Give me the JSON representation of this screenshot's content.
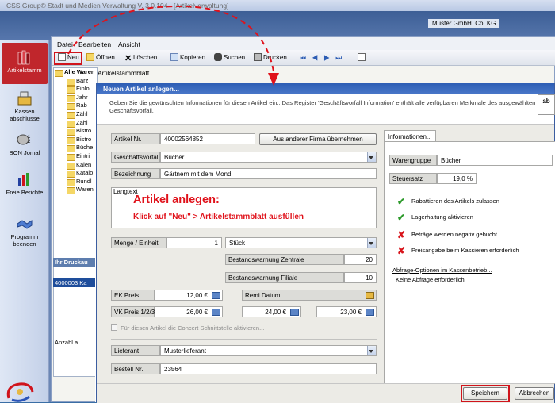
{
  "app": {
    "title": "CSS Group® Stadt und Medien Verwaltung V. 3.0.104 - [Artikelverwaltung]",
    "company": "Muster GmbH .Co. KG"
  },
  "leftnav": {
    "items": [
      {
        "label": "Artikelstamm",
        "icon": "books-icon"
      },
      {
        "label": "Kassen abschlüsse",
        "icon": "cash-register-icon"
      },
      {
        "label": "BON Jornal",
        "icon": "journal-icon"
      },
      {
        "label": "Freie Berichte",
        "icon": "report-chart-icon"
      },
      {
        "label": "Programm beenden",
        "icon": "handshake-icon"
      }
    ]
  },
  "menu": {
    "items": [
      "Datei",
      "Bearbeiten",
      "Ansicht"
    ]
  },
  "toolbar": {
    "neu": "Neu",
    "oeffnen": "Öffnen",
    "loeschen": "Löschen",
    "kopieren": "Kopieren",
    "suchen": "Suchen",
    "drucken": "Drucken"
  },
  "tree": {
    "root": "Alle Waren",
    "items": [
      "Barz",
      "Einlo",
      "Jahr",
      "Rab",
      "Zähl",
      "Zähl",
      "Bistro",
      "Bistro",
      "Büche",
      "Eintri",
      "Kalen",
      "Katalo",
      "Rundl",
      "Waren"
    ]
  },
  "grid": {
    "header": "Ihr Druckau",
    "row": "4000003  Ka",
    "anzahl": "Anzahl a"
  },
  "stammblatt": "Artikelstammblatt",
  "dialog": {
    "title": "Neuen Artikel anlegen...",
    "desc": "Geben Sie die gewünschten Informationen für diesen Artikel ein.. Das Register 'Geschäftsvorfall Information' enthält alle verfügbaren Merkmale des ausgewählten Geschäftsvorfall.",
    "icon": "ab"
  },
  "form": {
    "artikelnr_label": "Artikel Nr.",
    "artikelnr": "40002564852",
    "firma_button": "Aus anderer Firma übernehmen",
    "gv_label": "Geschäftsvorfall",
    "gv": "Bücher",
    "bez_label": "Bezeichnung",
    "bez": "Gärtnern mit dem Mond",
    "langtext_label": "Langtext",
    "menge_label": "Menge / Einheit",
    "menge": "1",
    "einheit": "Stück",
    "bw_zentrale_label": "Bestandswarnung Zentrale",
    "bw_zentrale": "20",
    "bw_filiale_label": "Bestandswarnung Filiale",
    "bw_filiale": "10",
    "ek_label": "EK Preis",
    "ek": "12,00 €",
    "remi_label": "Remi Datum",
    "vk_label": "VK Preis 1/2/3",
    "vk1": "26,00 €",
    "vk2": "24,00 €",
    "vk3": "23,00 €",
    "concert": "Für diesen Artikel die Concert Schnittstelle aktivieren...",
    "lief_label": "Lieferant",
    "lief": "Musterlieferant",
    "bestell_label": "Bestell Nr.",
    "bestell": "23564"
  },
  "overlay": {
    "title": "Artikel anlegen:",
    "subtitle": "Klick auf \"Neu\" > Artikelstammblatt ausfüllen"
  },
  "info": {
    "tab": "Informationen...",
    "wg_label": "Warengruppe",
    "wg": "Bücher",
    "steuer_label": "Steuersatz",
    "steuer": "19,0 %",
    "checks": [
      {
        "label": "Rabattieren des Artikels zulassen",
        "on": true
      },
      {
        "label": "Lagerhaltung aktivieren",
        "on": true
      },
      {
        "label": "Beträge werden negativ gebucht",
        "on": false
      },
      {
        "label": "Preisangabe beim Kassieren erforderlich",
        "on": false
      }
    ],
    "abfrage_link": "Abfrage-Optionen im Kassenbetrieb...",
    "abfrage_value": "Keine Abfrage erforderlich"
  },
  "buttons": {
    "save": "Speichern",
    "cancel": "Abbrechen"
  },
  "colors": {
    "highlight": "#d0141c",
    "dialog_title": "#2d5db4",
    "check_yes": "#2d9a2b",
    "check_no": "#d8141b"
  }
}
